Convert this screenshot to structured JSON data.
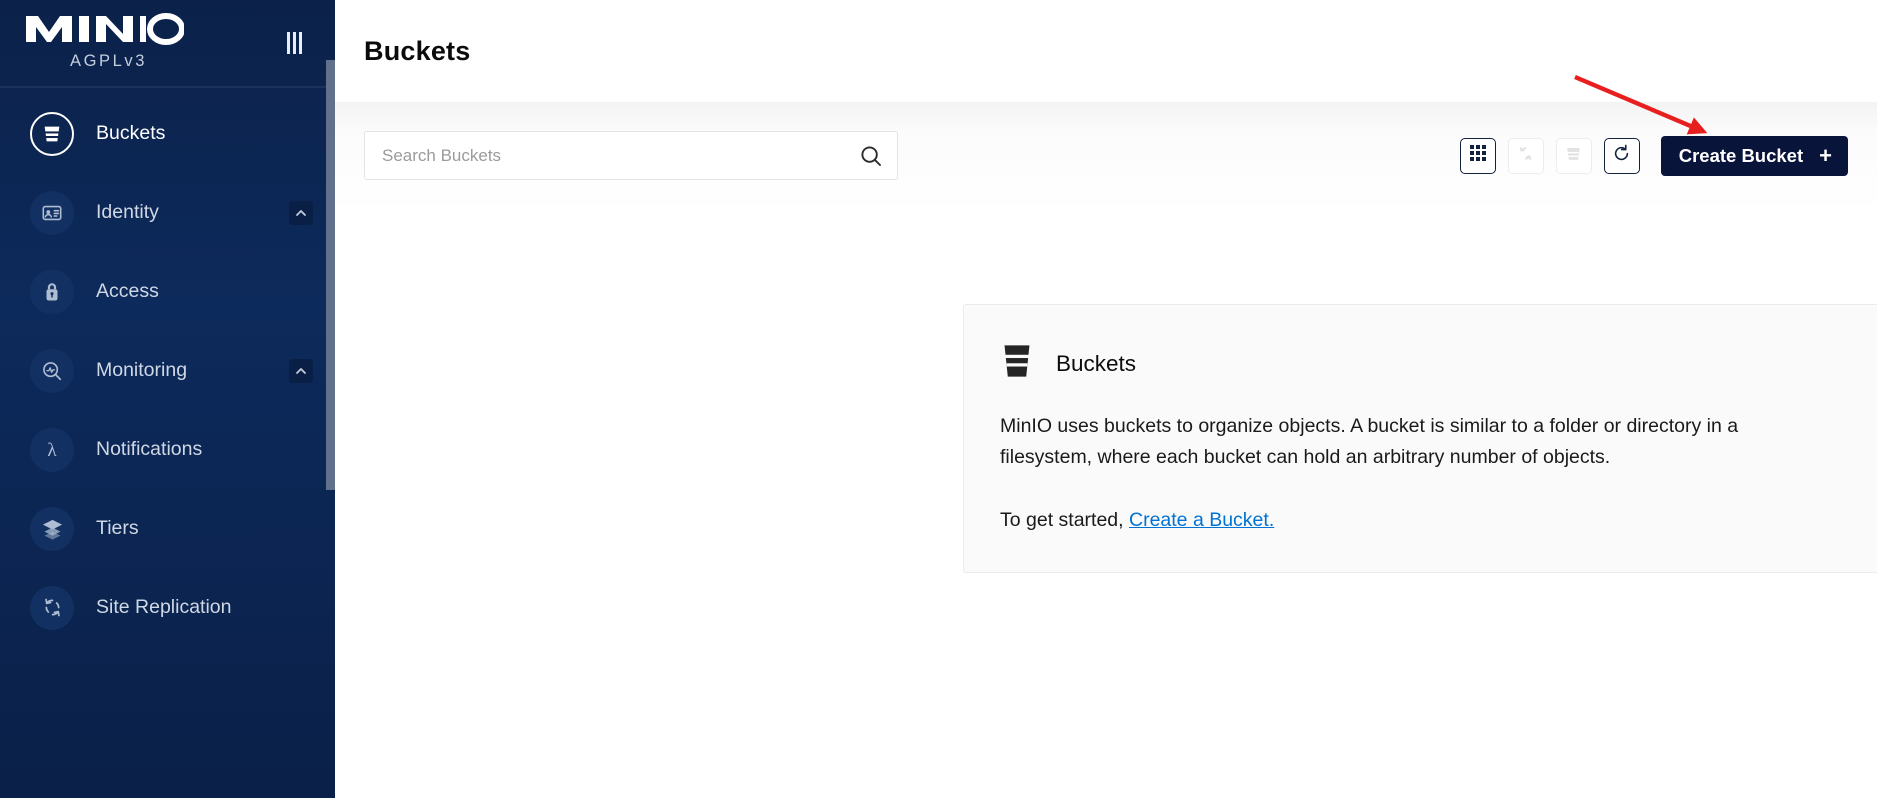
{
  "sidebar": {
    "logo_text": "MINIO",
    "license": "AGPLv3",
    "collapse_icon": "collapse-bars-icon",
    "items": [
      {
        "label": "Buckets",
        "icon": "bucket-icon",
        "active": true,
        "chevron": false
      },
      {
        "label": "Identity",
        "icon": "identity-card-icon",
        "active": false,
        "chevron": true
      },
      {
        "label": "Access",
        "icon": "lock-icon",
        "active": false,
        "chevron": false
      },
      {
        "label": "Monitoring",
        "icon": "monitoring-icon",
        "active": false,
        "chevron": true
      },
      {
        "label": "Notifications",
        "icon": "lambda-icon",
        "active": false,
        "chevron": false
      },
      {
        "label": "Tiers",
        "icon": "layers-icon",
        "active": false,
        "chevron": false
      },
      {
        "label": "Site Replication",
        "icon": "sync-arrows-icon",
        "active": false,
        "chevron": false
      }
    ]
  },
  "header": {
    "title": "Buckets"
  },
  "search": {
    "placeholder": "Search Buckets",
    "value": "",
    "icon": "search-icon"
  },
  "toolbar": {
    "buttons": [
      {
        "name": "grid-view-button",
        "icon": "grid-3x3-icon",
        "disabled": false
      },
      {
        "name": "replication-button",
        "icon": "sync-arrows-icon",
        "disabled": true
      },
      {
        "name": "delete-bucket-button",
        "icon": "bucket-icon",
        "disabled": true
      },
      {
        "name": "refresh-button",
        "icon": "refresh-icon",
        "disabled": false
      }
    ],
    "create_label": "Create Bucket",
    "create_plus": "+"
  },
  "card": {
    "icon": "bucket-icon",
    "title": "Buckets",
    "description": "MinIO uses buckets to organize objects. A bucket is similar to a folder or directory in a filesystem, where each bucket can hold an arbitrary number of objects.",
    "started_prefix": "To get started, ",
    "started_link": "Create a Bucket."
  },
  "annotation": {
    "arrow_color": "#e81f1f"
  }
}
